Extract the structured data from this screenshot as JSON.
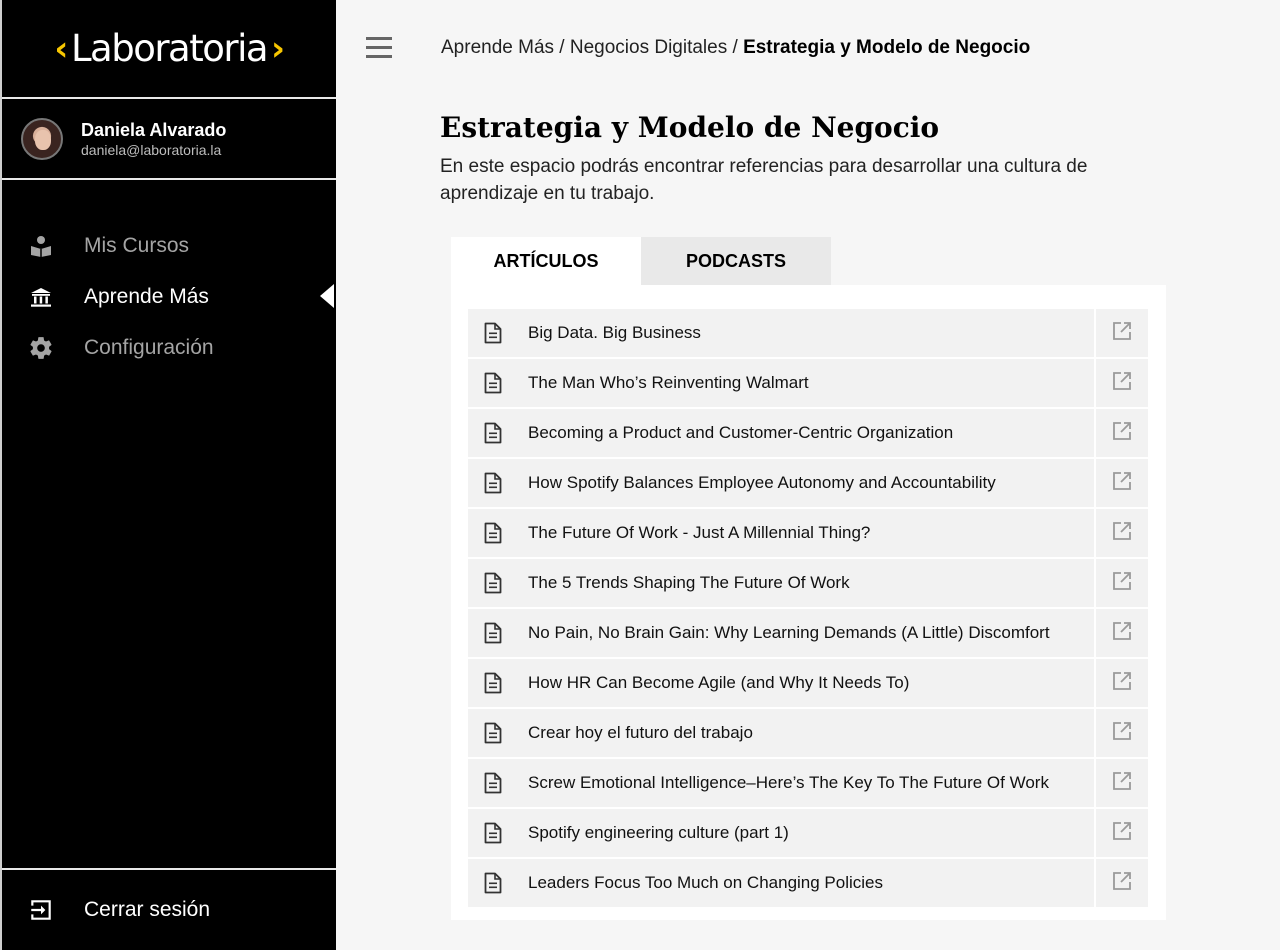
{
  "brand": {
    "name": "Laboratoria",
    "accent": "#f7c600"
  },
  "user": {
    "name": "Daniela Alvarado",
    "email": "daniela@laboratoria.la"
  },
  "nav": {
    "items": [
      {
        "label": "Mis Cursos",
        "icon": "course-icon",
        "active": false
      },
      {
        "label": "Aprende Más",
        "icon": "institution-icon",
        "active": true
      },
      {
        "label": "Configuración",
        "icon": "gear-icon",
        "active": false
      }
    ],
    "logout": "Cerrar sesión"
  },
  "breadcrumb": {
    "items": [
      "Aprende Más",
      "Negocios Digitales"
    ],
    "separator": "/",
    "current": "Estrategia y Modelo de Negocio"
  },
  "page": {
    "title": "Estrategia y Modelo de Negocio",
    "description": "En este espacio podrás encontrar referencias para desarrollar una cultura de aprendizaje en tu trabajo."
  },
  "tabs": [
    {
      "label": "ARTÍCULOS",
      "active": true
    },
    {
      "label": "PODCASTS",
      "active": false
    }
  ],
  "articles": [
    "Big Data. Big Business",
    "The Man Who’s Reinventing Walmart",
    "Becoming a Product and Customer-Centric Organization",
    "How Spotify Balances Employee Autonomy and Accountability",
    "The Future Of Work - Just A Millennial Thing?",
    "The 5 Trends Shaping The Future Of Work",
    "No Pain, No Brain Gain: Why Learning Demands (A Little) Discomfort",
    "How HR Can Become Agile (and Why It Needs To)",
    "Crear hoy el futuro del trabajo",
    "Screw Emotional Intelligence–Here’s The Key To The Future Of Work",
    "Spotify engineering culture (part 1)",
    "Leaders Focus Too Much on Changing Policies"
  ]
}
